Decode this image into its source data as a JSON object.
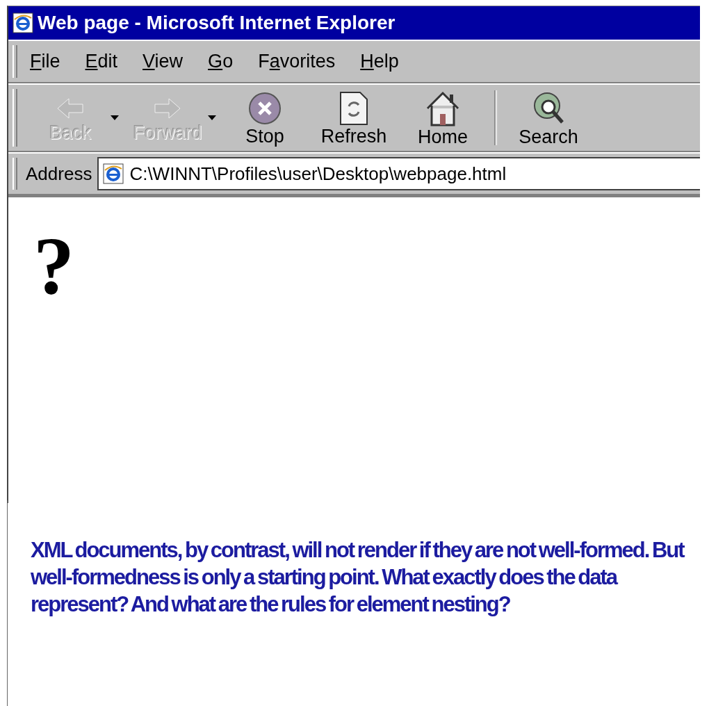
{
  "window": {
    "title": "Web page - Microsoft Internet Explorer"
  },
  "menu": [
    {
      "access_key": "F",
      "after": "ile"
    },
    {
      "access_key": "E",
      "after": "dit"
    },
    {
      "access_key": "V",
      "after": "iew"
    },
    {
      "access_key": "G",
      "after": "o"
    },
    {
      "before": "F",
      "access_key": "a",
      "after": "vorites"
    },
    {
      "access_key": "H",
      "after": "elp"
    }
  ],
  "toolbar": [
    {
      "kind": "back",
      "label": "Back",
      "disabled": true,
      "dropdown": true
    },
    {
      "kind": "forward",
      "label": "Forward",
      "disabled": true,
      "dropdown": true
    },
    {
      "kind": "stop",
      "label": "Stop",
      "disabled": false,
      "dropdown": false
    },
    {
      "kind": "refresh",
      "label": "Refresh",
      "disabled": false,
      "dropdown": false
    },
    {
      "kind": "home",
      "label": "Home",
      "disabled": false,
      "dropdown": false
    },
    {
      "kind": "search",
      "label": "Search",
      "disabled": false,
      "dropdown": false
    }
  ],
  "address": {
    "label": "Address",
    "value": "C:\\WINNT\\Profiles\\user\\Desktop\\webpage.html"
  },
  "content": {
    "text": "?"
  },
  "caption": "XML documents, by contrast, will not render if they are not well-formed. But well-formedness is only a starting point. What exactly does the data represent? And what are the rules for element nesting?"
}
